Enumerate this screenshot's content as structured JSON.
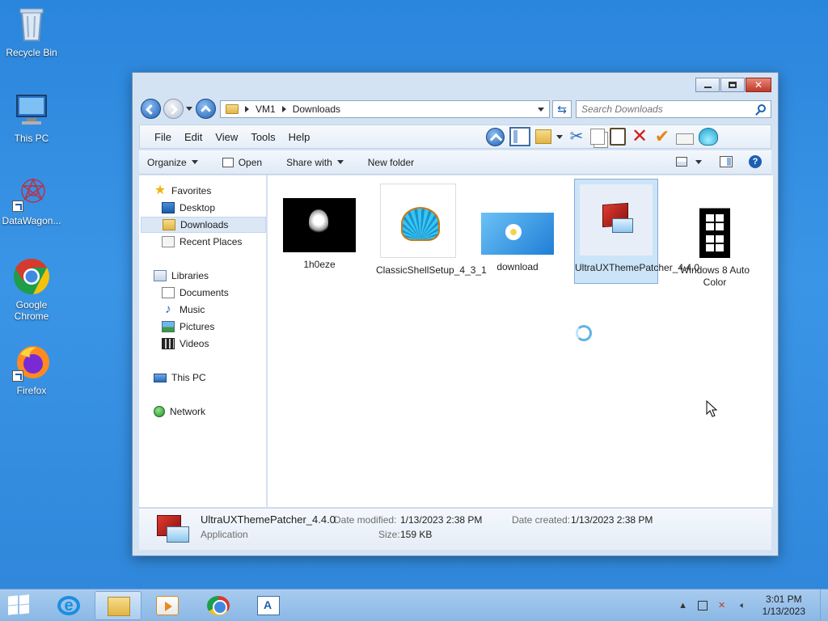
{
  "desktop": {
    "icons": [
      {
        "label": "Recycle Bin",
        "icon": "recycle-bin-icon"
      },
      {
        "label": "This PC",
        "icon": "computer-icon"
      },
      {
        "label": "DataWagon...",
        "icon": "datawagon-icon"
      },
      {
        "label": "Google Chrome",
        "icon": "chrome-icon"
      },
      {
        "label": "Firefox",
        "icon": "firefox-icon"
      }
    ]
  },
  "explorer": {
    "address": {
      "crumbs": [
        "VM1",
        "Downloads"
      ]
    },
    "search": {
      "placeholder": "Search Downloads"
    },
    "menu": [
      "File",
      "Edit",
      "View",
      "Tools",
      "Help"
    ],
    "commands": {
      "organize": "Organize",
      "open": "Open",
      "share_with": "Share with",
      "new_folder": "New folder"
    },
    "nav": {
      "favorites": "Favorites",
      "desktop": "Desktop",
      "downloads": "Downloads",
      "recent_places": "Recent Places",
      "libraries": "Libraries",
      "documents": "Documents",
      "music": "Music",
      "pictures": "Pictures",
      "videos": "Videos",
      "this_pc": "This PC",
      "network": "Network",
      "selected": "Downloads"
    },
    "files": [
      {
        "name": "1h0eze",
        "selected": false
      },
      {
        "name": "ClassicShellSetup_4_3_1",
        "selected": false
      },
      {
        "name": "download",
        "selected": false
      },
      {
        "name": "UltraUXThemePatcher_4.4.0",
        "selected": true
      },
      {
        "name": "Windows 8 Auto Color",
        "selected": false
      }
    ],
    "details": {
      "name": "UltraUXThemePatcher_4.4.0",
      "type": "Application",
      "modified_label": "Date modified:",
      "modified_value": "1/13/2023 2:38 PM",
      "created_label": "Date created:",
      "created_value": "1/13/2023 2:38 PM",
      "size_label": "Size:",
      "size_value": "159 KB"
    }
  },
  "taskbar": {
    "pinned": [
      "internet-explorer-icon",
      "file-explorer-icon",
      "vlc-icon",
      "chrome-icon",
      "wordpad-icon"
    ],
    "active": "file-explorer-icon",
    "clock": {
      "time": "3:01 PM",
      "date": "1/13/2023"
    }
  },
  "colors": {
    "desktop": "#2f86da",
    "selection": "#cce4f7",
    "taskbar": "#a8cbee"
  }
}
